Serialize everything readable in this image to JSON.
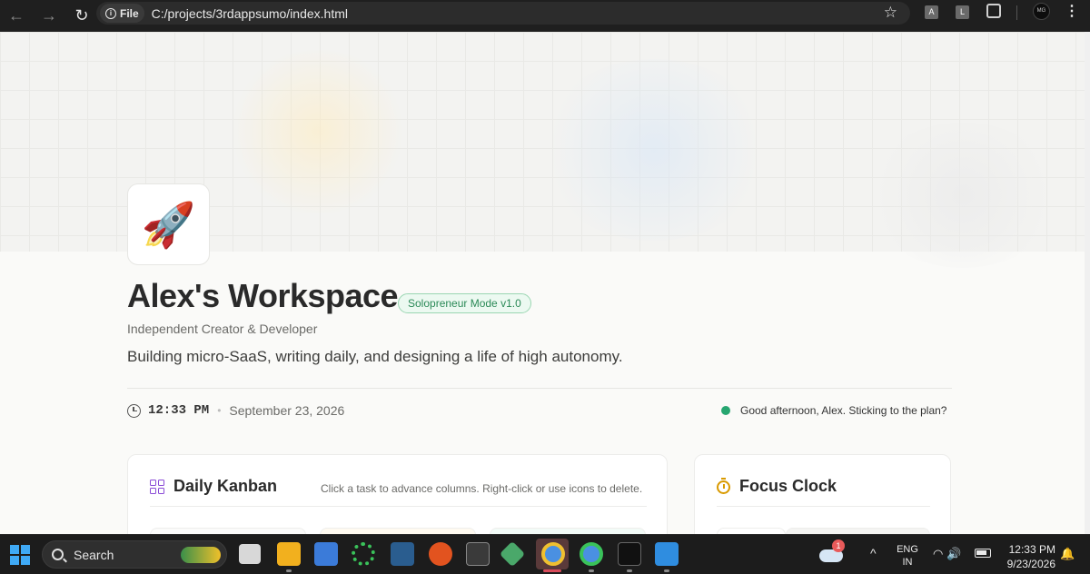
{
  "browser": {
    "file_label": "File",
    "url": "C:/projects/3rdappsumo/index.html",
    "ext_a": "A",
    "ext_l": "L",
    "profile": "MG"
  },
  "hero": {
    "icon": "🚀",
    "title": "Alex's Workspace",
    "badge": "Solopreneur Mode v1.0",
    "subtitle": "Independent Creator & Developer",
    "description": "Building micro-SaaS, writing daily, and designing a life of high autonomy."
  },
  "status": {
    "time": "12:33 PM",
    "separator": "•",
    "date": "September 23, 2026",
    "greeting": "Good afternoon, Alex. Sticking to the plan?"
  },
  "kanban": {
    "title": "Daily Kanban",
    "hint": "Click a task to advance columns. Right-click or use icons to delete."
  },
  "focus": {
    "title": "Focus Clock"
  },
  "taskbar": {
    "search_label": "Search",
    "lang_top": "ENG",
    "lang_bottom": "IN",
    "time": "12:33 PM",
    "date": "9/23/2026",
    "notification_count": "1"
  },
  "colors": {
    "accent_green": "#26a670",
    "badge_green": "#2b8a57",
    "kanban_icon": "#8a4bd6",
    "focus_icon": "#d99a00",
    "windows_blue": "#3fa9f5"
  }
}
